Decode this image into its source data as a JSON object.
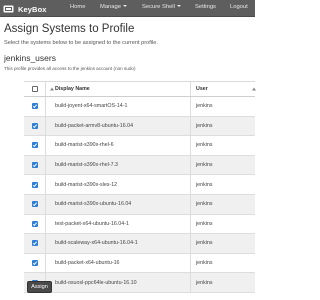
{
  "navbar": {
    "brand": "KeyBox",
    "items": [
      {
        "label": "Home",
        "dropdown": false
      },
      {
        "label": "Manage",
        "dropdown": true
      },
      {
        "label": "Secure Shell",
        "dropdown": true
      },
      {
        "label": "Settings",
        "dropdown": false
      },
      {
        "label": "Logout",
        "dropdown": false
      }
    ]
  },
  "page": {
    "title": "Assign Systems to Profile",
    "subtitle": "Select the systems below to be assigned to the current profile.",
    "profile_name": "jenkins_users",
    "profile_desc": "This profile provides all access to the jenkins account (non sudo)"
  },
  "table": {
    "columns": {
      "display_name": "Display Name",
      "user": "User"
    },
    "rows": [
      {
        "display_name": "build-joyent-x64-smartOS-14-1",
        "user": "jenkins",
        "checked": true
      },
      {
        "display_name": "build-packet-armv8-ubuntu-16.04",
        "user": "jenkins",
        "checked": true
      },
      {
        "display_name": "build-marist-s390x-rhel-6",
        "user": "jenkins",
        "checked": true
      },
      {
        "display_name": "build-marist-s390x-rhel-7.3",
        "user": "jenkins",
        "checked": true
      },
      {
        "display_name": "build-marist-s390x-sles-12",
        "user": "jenkins",
        "checked": true
      },
      {
        "display_name": "build-marist-s390x-ubuntu-16.04",
        "user": "jenkins",
        "checked": true
      },
      {
        "display_name": "test-packet-x64-ubuntu-16.04-1",
        "user": "jenkins",
        "checked": true
      },
      {
        "display_name": "build-scaleway-x64-ubuntu-16.04-1",
        "user": "jenkins",
        "checked": true
      },
      {
        "display_name": "build-packet-x64-ubuntu-16",
        "user": "jenkins",
        "checked": true
      },
      {
        "display_name": "build-osuosl-ppc64le-ubuntu-16.10",
        "user": "jenkins",
        "checked": true
      }
    ]
  },
  "actions": {
    "assign_label": "Assign"
  },
  "colors": {
    "navbar": "#5e5e5e",
    "checkbox": "#2f7fd6",
    "row_alt": "#f0f0f0",
    "button": "#4a4a4a"
  }
}
